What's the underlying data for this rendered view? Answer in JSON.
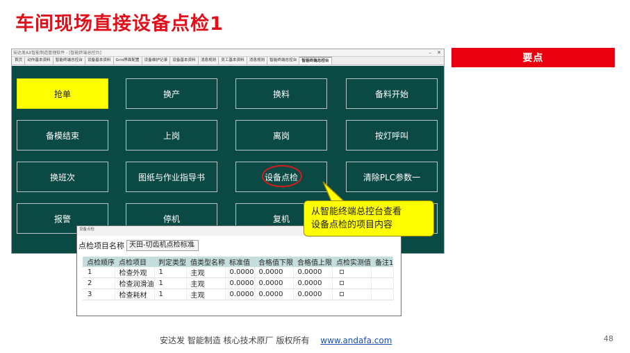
{
  "slide": {
    "title": "车间现场直接设备点检1",
    "keypoint_label": "要点",
    "callout_line1": "从智能终端总控台查看",
    "callout_line2": "设备点检的项目内容",
    "page_number": "48"
  },
  "footer": {
    "text": "安达发   智能制造 核心技术原厂    版权所有",
    "link": "www.andafa.com"
  },
  "app": {
    "title": "安达发AX智能制造管理软件 - [智能终端总控台]",
    "tabs": [
      {
        "label": "首页",
        "active": false
      },
      {
        "label": "动作基本资料",
        "active": false
      },
      {
        "label": "智能终端总控台",
        "active": false
      },
      {
        "label": "设备基本资料",
        "active": false
      },
      {
        "label": "Grid界面配置",
        "active": false
      },
      {
        "label": "设备维护记录",
        "active": false
      },
      {
        "label": "设备基本资料",
        "active": false
      },
      {
        "label": "消息规则",
        "active": false
      },
      {
        "label": "员工基本资料",
        "active": false
      },
      {
        "label": "消息规则",
        "active": false
      },
      {
        "label": "智能终端总控台",
        "active": false
      },
      {
        "label": "智能终端总控台",
        "active": true
      }
    ],
    "tiles": {
      "r1": [
        "抢单",
        "换产",
        "换料",
        "备料开始"
      ],
      "r2": [
        "备模结束",
        "上岗",
        "离岗",
        "按灯呼叫"
      ],
      "r3": [
        "换班次",
        "图纸与作业指导书",
        "设备点检",
        "清除PLC参数一"
      ],
      "r4": [
        "报警",
        "停机",
        "复机",
        ""
      ]
    },
    "highlight_color": "#ffff00",
    "panel_color": "#0b4a44"
  },
  "dialog": {
    "title": "设备点检",
    "field_label": "点检项目名称",
    "field_value": "天田-切齿机点检标准",
    "columns": [
      "点检顺序",
      "点检项目",
      "判定类型",
      "值类型名称",
      "标准值",
      "合格值下限",
      "合格值上限",
      "点检实测值",
      "备注1"
    ],
    "rows": [
      [
        "1",
        "检查外观",
        "1",
        "主观",
        "0.0000",
        "0.0000",
        "0.0000",
        "",
        ""
      ],
      [
        "2",
        "检查润滑油",
        "1",
        "主观",
        "0.0000",
        "0.0000",
        "0.0000",
        "",
        ""
      ],
      [
        "3",
        "检查耗材",
        "1",
        "主观",
        "0.0000",
        "0.0000",
        "0.0000",
        "",
        ""
      ]
    ]
  }
}
